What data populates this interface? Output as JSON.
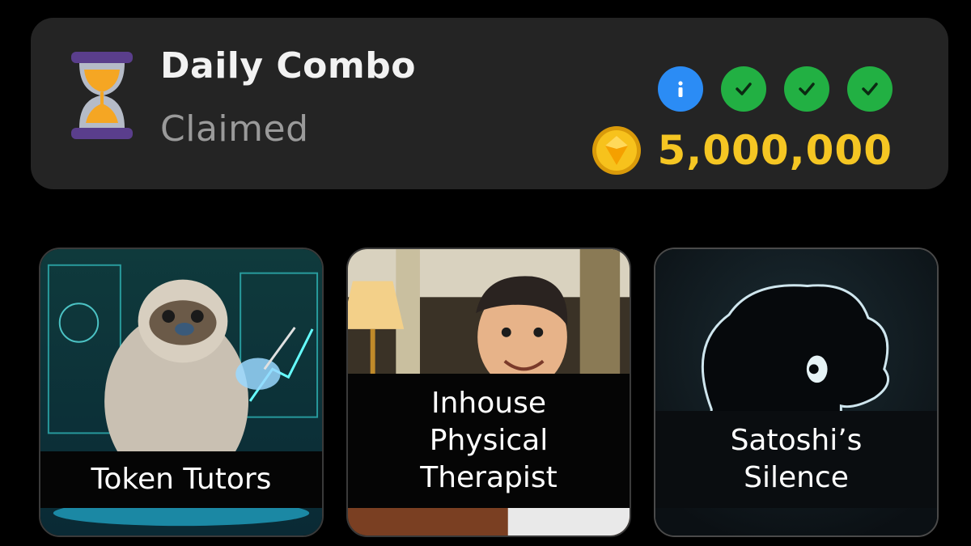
{
  "combo": {
    "title": "Daily Combo",
    "status": "Claimed",
    "reward": "5,000,000",
    "badges": [
      {
        "type": "info",
        "icon": "info-icon"
      },
      {
        "type": "check",
        "icon": "checkmark-icon"
      },
      {
        "type": "check",
        "icon": "checkmark-icon"
      },
      {
        "type": "check",
        "icon": "checkmark-icon"
      }
    ],
    "hourglass_icon": "hourglass-icon",
    "coin_icon": "gold-coin-icon"
  },
  "cards": [
    {
      "label": "Token Tutors",
      "art": "sloth-teacher-hologram"
    },
    {
      "label": "Inhouse\nPhysical\nTherapist",
      "art": "smiling-man-hotel-hallway"
    },
    {
      "label": "Satoshi’s\nSilence",
      "art": "silhouette-profile"
    }
  ],
  "colors": {
    "background": "#000000",
    "card_bg": "#242424",
    "title": "#f2f2f2",
    "status": "#9a9a9a",
    "reward": "#f5c623",
    "info": "#2b8cf5",
    "check": "#22b043"
  }
}
